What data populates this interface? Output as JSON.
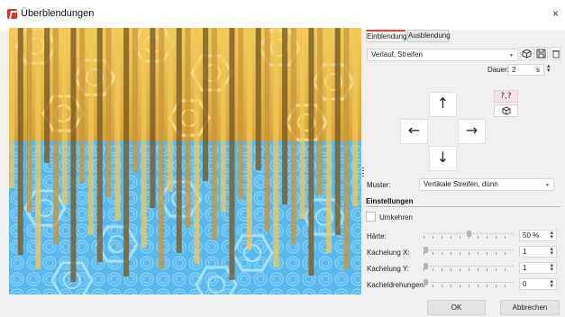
{
  "window": {
    "title": "Überblendungen",
    "close": "×"
  },
  "tabs": [
    {
      "label": "Einblendung",
      "active": true
    },
    {
      "label": "Ausblendung",
      "active": false
    }
  ],
  "transition": {
    "selected": "Verlauf, Streifen"
  },
  "duration": {
    "label": "Dauer:",
    "value": "2",
    "unit": "s"
  },
  "direction_arrows": {
    "up": "↑",
    "left": "←",
    "right": "→",
    "down": "↓"
  },
  "side_buttons": {
    "random_label": "?,?"
  },
  "pattern": {
    "label": "Muster:",
    "selected": "Vertikale Streifen, dünn"
  },
  "settings": {
    "title": "Einstellungen",
    "invert_label": "Umkehren",
    "invert_checked": false,
    "rows": [
      {
        "label": "Härte:",
        "value": "50 %",
        "fraction": 0.5
      },
      {
        "label": "Kachelung X:",
        "value": "1",
        "fraction": 0.0
      },
      {
        "label": "Kachelung Y:",
        "value": "1",
        "fraction": 0.0
      },
      {
        "label": "Kacheldrehungen:",
        "value": "0",
        "fraction": 0.0
      }
    ]
  },
  "buttons": {
    "ok": "OK",
    "cancel": "Abbrechen"
  },
  "colors": {
    "accent": "#e2443b",
    "preview_sky": "#59b9ef",
    "preview_gold": "#e8bc4a",
    "preview_brown": "#6b4f22"
  },
  "icons": {
    "app": "app-icon",
    "cube": "cube-icon",
    "save": "save-icon",
    "delete": "trash-icon",
    "random": "random-icon",
    "cube_direction": "cube-icon"
  }
}
